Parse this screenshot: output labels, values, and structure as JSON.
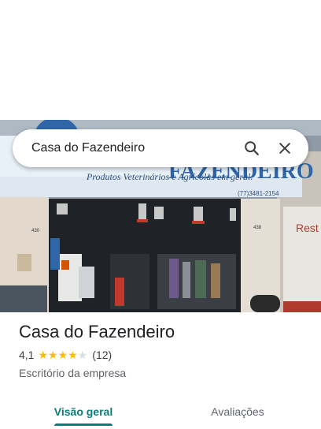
{
  "search": {
    "value": "Casa do Fazendeiro",
    "search_icon": "search-icon",
    "close_icon": "close-icon"
  },
  "photo": {
    "sign_main": "FAZENDEIRO",
    "sign_sub": "Produtos Veterinários e Agrícolas em geral.",
    "sign_phone": "(77)3481-2154",
    "door_number_left": "430",
    "door_number_right": "438",
    "neighbor_sign": "Rest"
  },
  "place": {
    "name": "Casa do Fazendeiro",
    "rating": "4,1",
    "rating_value": 4.1,
    "stars_total": 5,
    "review_count": "(12)",
    "category": "Escritório da empresa"
  },
  "tabs": [
    {
      "label": "Visão geral",
      "active": true
    },
    {
      "label": "Avaliações",
      "active": false
    }
  ],
  "colors": {
    "accent": "#0b7d7a",
    "star": "#fbbc04"
  }
}
